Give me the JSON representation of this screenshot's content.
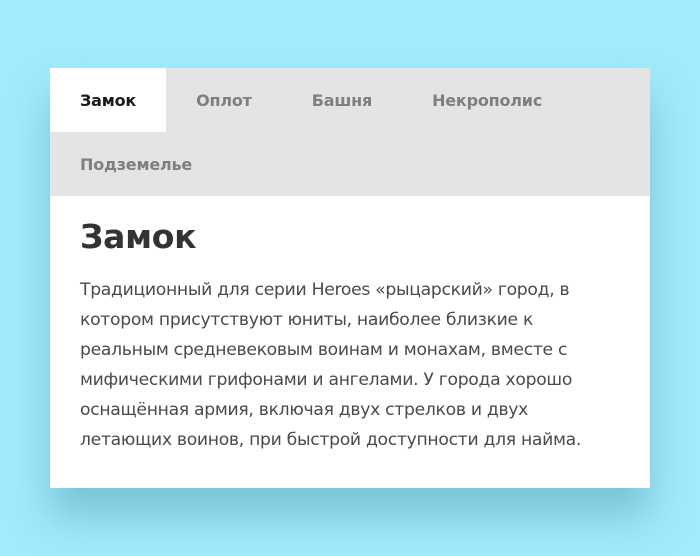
{
  "tabs": [
    {
      "label": "Замок",
      "active": true
    },
    {
      "label": "Оплот",
      "active": false
    },
    {
      "label": "Башня",
      "active": false
    },
    {
      "label": "Некрополис",
      "active": false
    },
    {
      "label": "Подземелье",
      "active": false
    }
  ],
  "panel": {
    "title": "Замок",
    "text": "Традиционный для серии Heroes «рыцарский» город, в котором присутствуют юниты, наиболее близкие к реальным средневековым воинам и монахам, вместе с мифическими грифонами и ангелами. У города хорошо оснащённая армия, включая двух стрелков и двух летающих воинов, при быстрой доступности для найма."
  },
  "colors": {
    "background": "#a0ebfc",
    "tabbar": "#e4e4e4",
    "active_tab": "#ffffff",
    "inactive_tab_text": "#7f7f7f"
  }
}
